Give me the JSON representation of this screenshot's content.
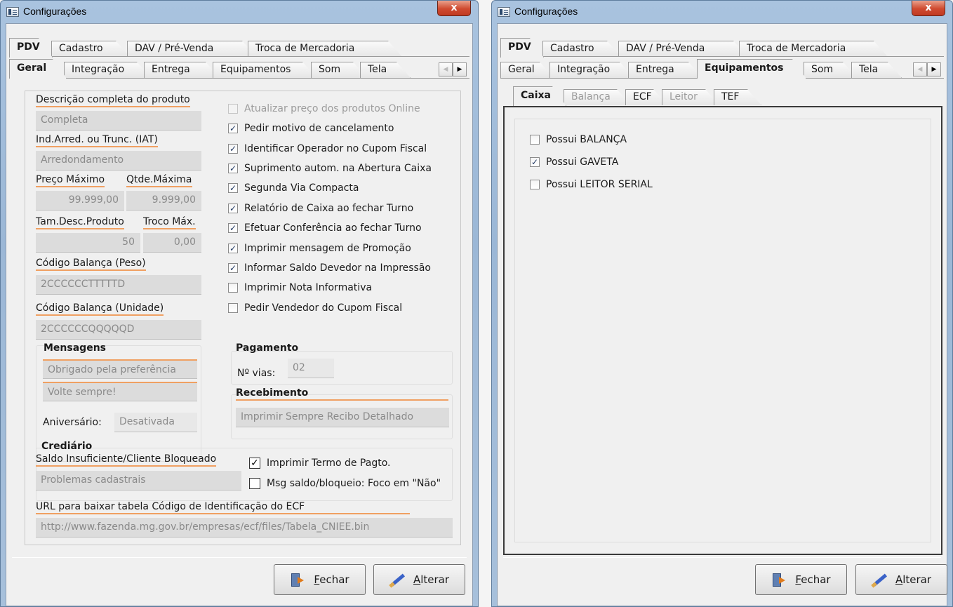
{
  "left": {
    "title": "Configurações",
    "close": "x",
    "top_tabs": [
      "PDV",
      "Cadastro",
      "DAV / Pré-Venda",
      "Troca de Mercadoria"
    ],
    "sub_tabs": [
      "Geral",
      "Integração",
      "Entrega",
      "Equipamentos",
      "Som",
      "Tela"
    ],
    "arrows": {
      "left": "◀",
      "right": "▶"
    },
    "descricao": {
      "label": "Descrição completa do produto",
      "value": "Completa"
    },
    "ind_arred": {
      "label": "Ind.Arred. ou Trunc. (IAT)",
      "value": "Arredondamento"
    },
    "preco_max": {
      "label": "Preço Máximo",
      "value": "99.999,00"
    },
    "qtde_max": {
      "label": "Qtde.Máxima",
      "value": "9.999,00"
    },
    "tam_desc": {
      "label": "Tam.Desc.Produto",
      "value": "50"
    },
    "troco_max": {
      "label": "Troco Máx.",
      "value": "0,00"
    },
    "cod_bal_peso": {
      "label": "Código Balança (Peso)",
      "value": "2CCCCCCTTTTTD"
    },
    "cod_bal_unid": {
      "label": "Código Balança (Unidade)",
      "value": "2CCCCCCQQQQQD"
    },
    "checks": [
      {
        "label": "Atualizar preço dos produtos Online",
        "checked": false,
        "disabled": true
      },
      {
        "label": "Pedir motivo de cancelamento",
        "checked": true
      },
      {
        "label": "Identificar Operador no Cupom Fiscal",
        "checked": true
      },
      {
        "label": "Suprimento autom. na Abertura Caixa",
        "checked": true
      },
      {
        "label": "Segunda Via Compacta",
        "checked": true
      },
      {
        "label": "Relatório de Caixa ao fechar Turno",
        "checked": true
      },
      {
        "label": "Efetuar Conferência ao fechar Turno",
        "checked": true
      },
      {
        "label": "Imprimir mensagem de Promoção",
        "checked": true
      },
      {
        "label": "Informar Saldo Devedor na Impressão",
        "checked": true
      },
      {
        "label": "Imprimir Nota Informativa",
        "checked": false
      },
      {
        "label": "Pedir Vendedor do Cupom Fiscal",
        "checked": false
      }
    ],
    "mensagens": {
      "title": "Mensagens",
      "msg1": "Obrigado pela preferência",
      "msg2": "Volte sempre!",
      "aniv_label": "Aniversário:",
      "aniv_value": "Desativada"
    },
    "pagamento": {
      "title": "Pagamento",
      "vias_label": "Nº vias:",
      "vias_value": "02"
    },
    "recebimento": {
      "title": "Recebimento",
      "value": "Imprimir Sempre Recibo Detalhado"
    },
    "crediario": {
      "title": "Crediário",
      "saldo_label": "Saldo Insuficiente/Cliente Bloqueado",
      "saldo_value": "Problemas cadastrais",
      "termo": {
        "label": "Imprimir Termo de Pagto.",
        "checked": true
      },
      "foco": {
        "label": "Msg saldo/bloqueio: Foco em \"Não\"",
        "checked": false
      }
    },
    "url": {
      "label": "URL para baixar tabela Código de Identificação do ECF",
      "value": "http://www.fazenda.mg.gov.br/empresas/ecf/files/Tabela_CNIEE.bin"
    },
    "buttons": {
      "fechar_accel": "F",
      "fechar_rest": "echar",
      "alterar_accel": "A",
      "alterar_rest": "lterar"
    }
  },
  "right": {
    "title": "Configurações",
    "close": "x",
    "top_tabs": [
      "PDV",
      "Cadastro",
      "DAV / Pré-Venda",
      "Troca de Mercadoria"
    ],
    "sub_tabs": [
      "Geral",
      "Integração",
      "Entrega",
      "Equipamentos",
      "Som",
      "Tela"
    ],
    "arrows": {
      "left": "◀",
      "right": "▶"
    },
    "inner_tabs": [
      "Caixa",
      "Balança",
      "ECF",
      "Leitor",
      "TEF"
    ],
    "checks": [
      {
        "label": "Possui BALANÇA",
        "checked": false
      },
      {
        "label": "Possui GAVETA",
        "checked": true
      },
      {
        "label": "Possui LEITOR SERIAL",
        "checked": false
      }
    ],
    "buttons": {
      "fechar_accel": "F",
      "fechar_rest": "echar",
      "alterar_accel": "A",
      "alterar_rest": "lterar"
    }
  }
}
